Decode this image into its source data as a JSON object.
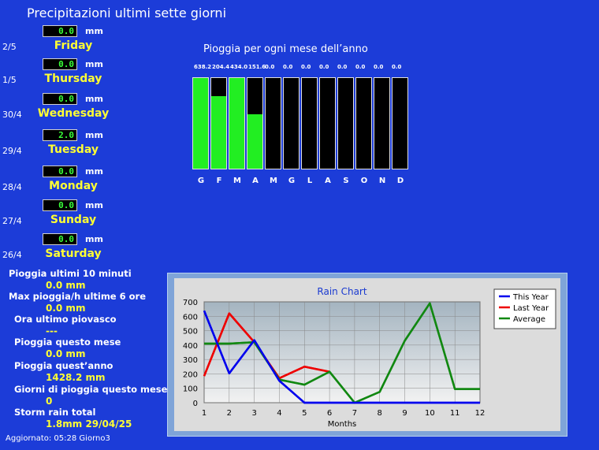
{
  "title": "Precipitazioni  ultimi sette giorni",
  "unit": "mm",
  "days": [
    {
      "date": "2/5",
      "value": "0.0",
      "name": "Friday"
    },
    {
      "date": "1/5",
      "value": "0.0",
      "name": "Thursday"
    },
    {
      "date": "30/4",
      "value": "0.0",
      "name": "Wednesday"
    },
    {
      "date": "29/4",
      "value": "2.0",
      "name": "Tuesday"
    },
    {
      "date": "28/4",
      "value": "0.0",
      "name": "Monday"
    },
    {
      "date": "27/4",
      "value": "0.0",
      "name": "Sunday"
    },
    {
      "date": "26/4",
      "value": "0.0",
      "name": "Saturday"
    }
  ],
  "monthly": {
    "title": "Pioggia per ogni mese dell’anno",
    "months": [
      "G",
      "F",
      "M",
      "A",
      "M",
      "G",
      "L",
      "A",
      "S",
      "O",
      "N",
      "D"
    ],
    "values": [
      638.2,
      204.4,
      434.0,
      151.6,
      0.0,
      0.0,
      0.0,
      0.0,
      0.0,
      0.0,
      0.0,
      0.0
    ],
    "labels": [
      "638.2",
      "204.4",
      "434.0",
      "151.6",
      "0.0",
      "0.0",
      "0.0",
      "0.0",
      "0.0",
      "0.0",
      "0.0",
      "0.0"
    ],
    "fill_fraction": [
      1.0,
      0.8,
      1.0,
      0.6,
      0,
      0,
      0,
      0,
      0,
      0,
      0,
      0
    ],
    "bar_color": "#22ee22"
  },
  "stats": [
    {
      "label": "Pioggia ultimi 10 minuti",
      "value": "0.0 mm"
    },
    {
      "label": "Max pioggia/h ultime 6 ore",
      "value": "0.0 mm"
    },
    {
      "label": "Ora ultimo piovasco",
      "value": "---"
    },
    {
      "label": "Pioggia questo mese",
      "value": "0.0 mm"
    },
    {
      "label": "Pioggia quest’anno",
      "value": "1428.2 mm"
    },
    {
      "label": "Giorni di pioggia questo mese",
      "value": "0"
    },
    {
      "label": "Storm rain total",
      "value": "1.8mm 29/04/25"
    }
  ],
  "updated": "Aggiornato: 05:28 Giorno3",
  "chart_data": {
    "type": "line",
    "title": "Rain Chart",
    "xlabel": "Months",
    "ylabel": "",
    "x": [
      1,
      2,
      3,
      4,
      5,
      6,
      7,
      8,
      9,
      10,
      11,
      12
    ],
    "xlim": [
      1,
      12
    ],
    "ylim": [
      0,
      700
    ],
    "yticks": [
      0,
      100,
      200,
      300,
      400,
      500,
      600,
      700
    ],
    "grid": true,
    "legend_position": "top-right",
    "series": [
      {
        "name": "This Year",
        "color": "#0000ee",
        "x": [
          1,
          2,
          3,
          4,
          5,
          6,
          7,
          8,
          9,
          10,
          11,
          12
        ],
        "values": [
          638,
          204,
          434,
          152,
          0,
          0,
          0,
          0,
          0,
          0,
          0,
          0
        ]
      },
      {
        "name": "Last Year",
        "color": "#ee0000",
        "x": [
          1,
          2,
          3,
          4,
          5,
          6
        ],
        "values": [
          185,
          620,
          420,
          170,
          250,
          215
        ]
      },
      {
        "name": "Average",
        "color": "#118811",
        "x": [
          1,
          2,
          3,
          4,
          5,
          6,
          7,
          8,
          9,
          10,
          11,
          12
        ],
        "values": [
          410,
          410,
          420,
          160,
          125,
          215,
          0,
          75,
          430,
          690,
          95,
          95
        ]
      }
    ]
  }
}
